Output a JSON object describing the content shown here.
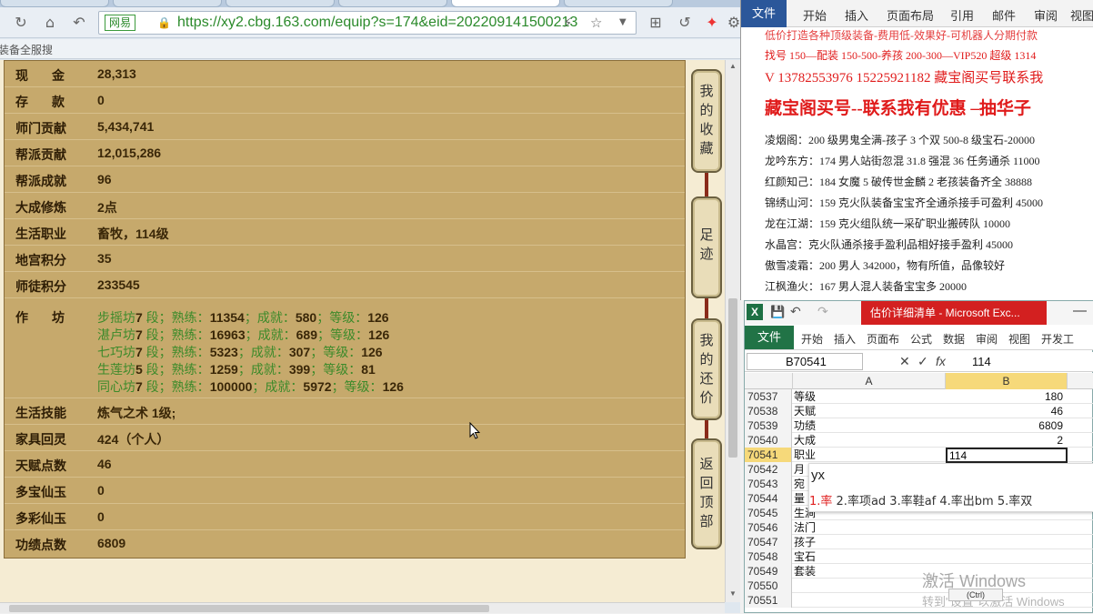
{
  "browser": {
    "url": "https://xy2.cbg.163.com/equip?s=174&eid=202209141500213",
    "site_badge": "网易",
    "bookmark": "装备全服搜",
    "rows": [
      {
        "key": "现 金",
        "val": "28,313"
      },
      {
        "key": "存 款",
        "val": "0"
      },
      {
        "key": "师门贡献",
        "val": "5,434,741"
      },
      {
        "key": "帮派贡献",
        "val": "12,015,286"
      },
      {
        "key": "帮派成就",
        "val": "96"
      },
      {
        "key": "大成修炼",
        "val": "2点"
      },
      {
        "key": "生活职业",
        "val": "畜牧，114级"
      },
      {
        "key": "地宫积分",
        "val": "35"
      },
      {
        "key": "师徒积分",
        "val": "233545"
      },
      {
        "key": "作 坊",
        "val": ""
      },
      {
        "key": "生活技能",
        "val": "炼气之术 1级;"
      },
      {
        "key": "家具回灵",
        "val": "424（个人）"
      },
      {
        "key": "天赋点数",
        "val": "46"
      },
      {
        "key": "多宝仙玉",
        "val": "0"
      },
      {
        "key": "多彩仙玉",
        "val": "0"
      },
      {
        "key": "功绩点数",
        "val": "6809"
      }
    ],
    "crafts": [
      {
        "name": "步摇坊",
        "seg": "7",
        "exp": "11354",
        "ach": "580",
        "lvl": "126"
      },
      {
        "name": "湛卢坊",
        "seg": "7",
        "exp": "16963",
        "ach": "689",
        "lvl": "126"
      },
      {
        "name": "七巧坊",
        "seg": "7",
        "exp": "5323",
        "ach": "307",
        "lvl": "126"
      },
      {
        "name": "生莲坊",
        "seg": "5",
        "exp": "1259",
        "ach": "399",
        "lvl": "81"
      },
      {
        "name": "同心坊",
        "seg": "7",
        "exp": "100000",
        "ach": "5972",
        "lvl": "126"
      }
    ],
    "craft_labels": {
      "seg": "段；熟练：",
      "ach": "；成就：",
      "lvl": "；等级："
    },
    "side_buttons": [
      {
        "label": "我的收藏"
      },
      {
        "label": "足迹"
      },
      {
        "label": "我的还价"
      },
      {
        "label": "返回顶部"
      }
    ]
  },
  "word": {
    "tabs": [
      "文件",
      "开始",
      "插入",
      "页面布局",
      "引用",
      "邮件",
      "审阅",
      "视图"
    ],
    "lines": [
      "低价打造各种顶级装备-费用低-效果好-可机器人分期付款",
      "找号 150—配装 150-500-养孩 200-300—VIP520 超级 1314",
      "V 13782553976    15225921182   藏宝阁买号联系我",
      "藏宝阁买号--联系我有优惠 –抽华子",
      "凌烟阁：200 级男鬼全满-孩子 3 个双 500-8 级宝石-20000",
      "龙吟东方：174 男人站街忽混 31.8 强混 36 任务通杀 11000",
      "红颜知己：184 女魔 5 破传世金麟 2 老孩装备齐全 38888",
      "锦绣山河：159 克火队装备宝宝齐全通杀接手可盈利 45000",
      "龙在江湖：159 克火组队统一采矿职业搬砖队 10000",
      "水晶宫：克火队通杀接手盈利品相好接手盈利 45000",
      "傲雪凌霜：200 男人 342000，物有所值，品像较好",
      "江枫渔火：167 男人混人装备宝宝多 20000"
    ]
  },
  "excel": {
    "doc_title": "估价详细清单 - Microsoft Exc...",
    "file_tab": "文件",
    "tabs": [
      "开始",
      "插入",
      "页面布",
      "公式",
      "数据",
      "审阅",
      "视图",
      "开发工"
    ],
    "namebox": "B70541",
    "formula_value": "114",
    "col_a": "A",
    "col_b": "B",
    "rows": [
      {
        "n": "70537",
        "a": "等级",
        "b": "180"
      },
      {
        "n": "70538",
        "a": "天赋",
        "b": "46"
      },
      {
        "n": "70539",
        "a": "功绩",
        "b": "6809"
      },
      {
        "n": "70540",
        "a": "大成",
        "b": "2"
      },
      {
        "n": "70541",
        "a": "职业",
        "b": "114"
      },
      {
        "n": "70542",
        "a": "月",
        "b": ""
      },
      {
        "n": "70543",
        "a": "宛",
        "b": ""
      },
      {
        "n": "70544",
        "a": "量",
        "b": ""
      },
      {
        "n": "70545",
        "a": "生涧",
        "b": ""
      },
      {
        "n": "70546",
        "a": "法门",
        "b": ""
      },
      {
        "n": "70547",
        "a": "孩子",
        "b": ""
      },
      {
        "n": "70548",
        "a": "宝石",
        "b": ""
      },
      {
        "n": "70549",
        "a": "套装",
        "b": ""
      },
      {
        "n": "70550",
        "a": "",
        "b": ""
      },
      {
        "n": "70551",
        "a": "",
        "b": ""
      }
    ],
    "ime_input": "yx",
    "ime_candidates": "1.率  2.率项ad  3.率鞋af  4.率出bm  5.率双",
    "watermark": "激活 Windows",
    "watermark_sub": "转到\"设置\"以激活 Windows",
    "paste_label": "(Ctrl)"
  }
}
